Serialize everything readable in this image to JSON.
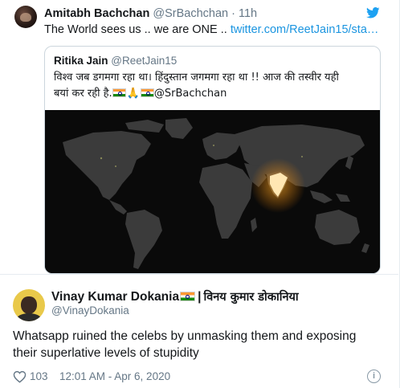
{
  "tweet": {
    "author_name": "Amitabh Bachchan",
    "author_handle": "@SrBachchan",
    "separator": "·",
    "time": "11h",
    "text": "The World sees us .. we are ONE .. ",
    "link": "twitter.com/ReetJain15/sta…",
    "bird_icon": "twitter-bird-icon",
    "brand_color": "#1da1f2"
  },
  "quoted": {
    "author_name": "Ritika Jain",
    "author_handle": "@ReetJain15",
    "text_line1": "विश्व जब डगमगा रहा था। हिंदुस्तान जगमगा रहा था !! आज की तस्वीर यही",
    "text_line2_start": "बयां कर रही है.",
    "mention": "@SrBachchan",
    "media": "world-map-night-image"
  },
  "reply": {
    "author_name": "Vinay Kumar Dokania",
    "separator": "|",
    "author_name_hindi": "विनय कुमार डोकानिया",
    "author_handle": "@VinayDokania",
    "text": "Whatsapp ruined the celebs by unmasking them and exposing their superlative levels of stupidity",
    "likes": "103",
    "timestamp": "12:01 AM - Apr 6, 2020",
    "info_label": "i"
  },
  "colors": {
    "text": "#14171a",
    "muted": "#657786",
    "link": "#1b95e0",
    "border": "#ccd6dd"
  }
}
